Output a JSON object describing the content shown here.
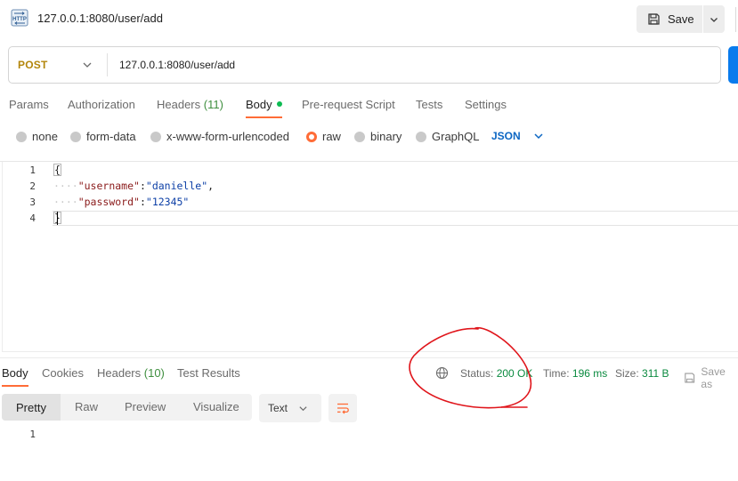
{
  "header": {
    "title": "127.0.0.1:8080/user/add",
    "icon": "http-request-icon",
    "save_label": "Save"
  },
  "request": {
    "method": "POST",
    "url": "127.0.0.1:8080/user/add"
  },
  "request_tabs": [
    {
      "label": "Params"
    },
    {
      "label": "Authorization"
    },
    {
      "label": "Headers",
      "count": "(11)"
    },
    {
      "label": "Body",
      "active": true
    },
    {
      "label": "Pre-request Script"
    },
    {
      "label": "Tests"
    },
    {
      "label": "Settings"
    }
  ],
  "body_types": [
    {
      "label": "none"
    },
    {
      "label": "form-data"
    },
    {
      "label": "x-www-form-urlencoded"
    },
    {
      "label": "raw",
      "selected": true
    },
    {
      "label": "binary"
    },
    {
      "label": "GraphQL"
    }
  ],
  "body_format": "JSON",
  "editor": {
    "line_numbers": [
      "1",
      "2",
      "3",
      "4"
    ],
    "open_brace": "{",
    "close_brace": "}",
    "whitespace_marker": "····",
    "fields": [
      {
        "key": "\"username\"",
        "colon": ":",
        "value": "\"danielle\"",
        "trail": ","
      },
      {
        "key": "\"password\"",
        "colon": ":",
        "value": "\"12345\"",
        "trail": ""
      }
    ]
  },
  "response_tabs": [
    {
      "label": "Body",
      "active": true
    },
    {
      "label": "Cookies"
    },
    {
      "label": "Headers",
      "count": "(10)"
    },
    {
      "label": "Test Results"
    }
  ],
  "response_meta": {
    "status_label": "Status:",
    "status_value": "200 OK",
    "time_label": "Time:",
    "time_value": "196 ms",
    "size_label": "Size:",
    "size_value": "311 B",
    "save_label": "Save as"
  },
  "response_view": {
    "modes": [
      "Pretty",
      "Raw",
      "Preview",
      "Visualize"
    ],
    "active_mode": "Pretty",
    "format": "Text",
    "line_numbers": [
      "1"
    ]
  },
  "colors": {
    "accent": "#ff6c37",
    "method": "#b3860b",
    "status_ok": "#0a8a3f",
    "json_link": "#0b66c3",
    "annotation": "#e0151b"
  }
}
